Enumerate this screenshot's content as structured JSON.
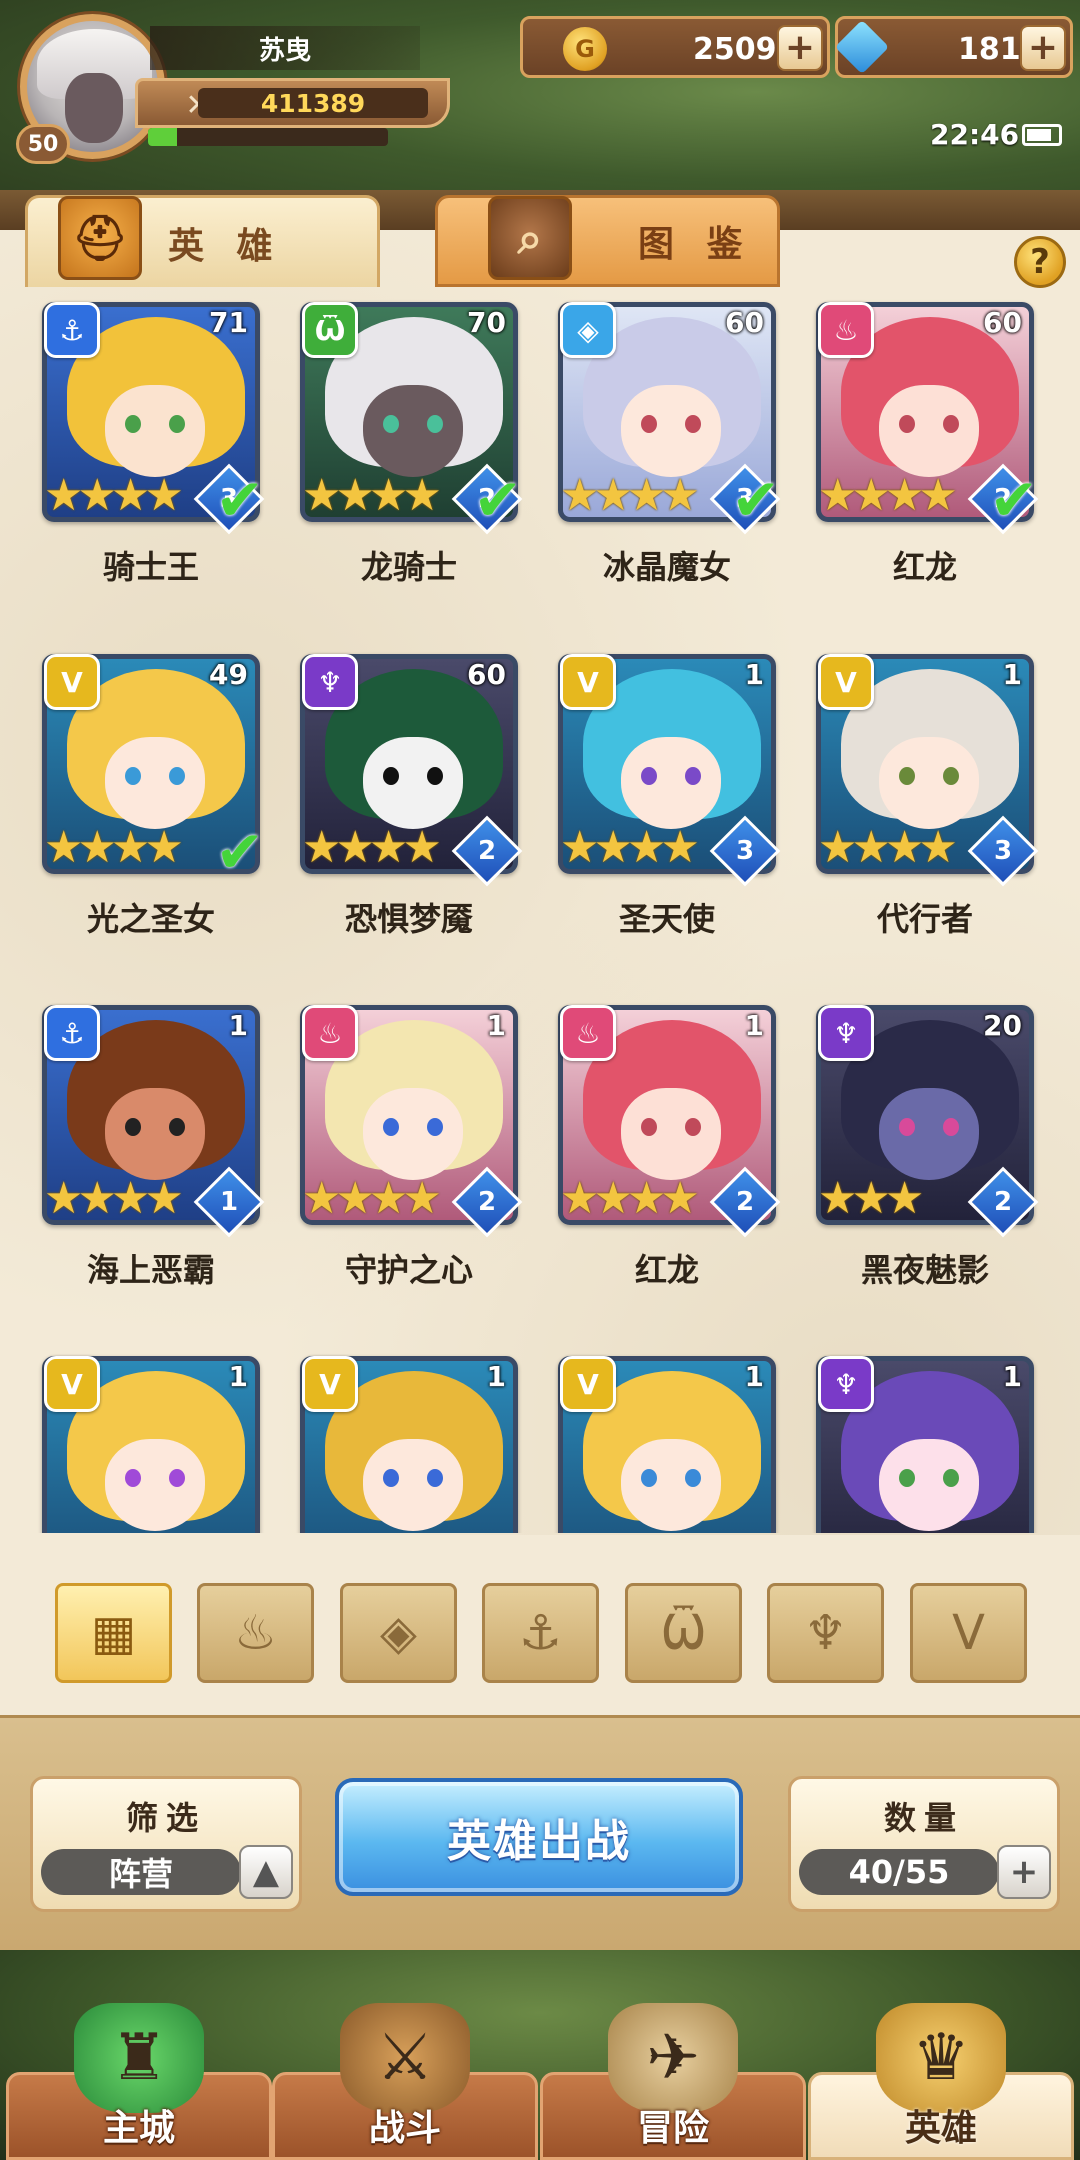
{
  "player": {
    "name": "苏曳",
    "level": "50",
    "power": "411389",
    "exp_fraction": 0.12
  },
  "currencies": {
    "gold": "2509",
    "gems": "181"
  },
  "status": {
    "time": "22:46"
  },
  "tabs": {
    "heroes": "英 雄",
    "codex": "图 鉴"
  },
  "heroes": [
    {
      "name": "骑士王",
      "level": "71",
      "rank": "3",
      "element": "anchor",
      "stars": 4,
      "checked": true
    },
    {
      "name": "龙骑士",
      "level": "70",
      "rank": "2",
      "element": "beast",
      "stars": 4,
      "checked": true
    },
    {
      "name": "冰晶魔女",
      "level": "60",
      "rank": "3",
      "element": "crystal",
      "stars": 4,
      "checked": true
    },
    {
      "name": "红龙",
      "level": "60",
      "rank": "2",
      "element": "flame",
      "stars": 4,
      "checked": true
    },
    {
      "name": "光之圣女",
      "level": "49",
      "rank": "",
      "element": "light",
      "stars": 4,
      "checked": true
    },
    {
      "name": "恐惧梦魇",
      "level": "60",
      "rank": "2",
      "element": "dark",
      "stars": 4,
      "checked": false
    },
    {
      "name": "圣天使",
      "level": "1",
      "rank": "3",
      "element": "light",
      "stars": 4,
      "checked": false
    },
    {
      "name": "代行者",
      "level": "1",
      "rank": "3",
      "element": "light",
      "stars": 4,
      "checked": false
    },
    {
      "name": "海上恶霸",
      "level": "1",
      "rank": "1",
      "element": "anchor",
      "stars": 4,
      "checked": false
    },
    {
      "name": "守护之心",
      "level": "1",
      "rank": "2",
      "element": "flame",
      "stars": 4,
      "checked": false
    },
    {
      "name": "红龙",
      "level": "1",
      "rank": "2",
      "element": "flame",
      "stars": 4,
      "checked": false
    },
    {
      "name": "黑夜魅影",
      "level": "20",
      "rank": "2",
      "element": "dark",
      "stars": 3,
      "checked": false
    },
    {
      "name": "",
      "level": "1",
      "rank": "",
      "element": "light",
      "stars": 0,
      "checked": false
    },
    {
      "name": "",
      "level": "1",
      "rank": "",
      "element": "light",
      "stars": 0,
      "checked": false
    },
    {
      "name": "",
      "level": "1",
      "rank": "",
      "element": "light",
      "stars": 0,
      "checked": false
    },
    {
      "name": "",
      "level": "1",
      "rank": "",
      "element": "dark",
      "stars": 0,
      "checked": false
    }
  ],
  "element_colors": {
    "anchor": "#2f6fe0",
    "beast": "#3fae3a",
    "crystal": "#3aa6e8",
    "flame": "#e04a78",
    "light": "#e6b81e",
    "dark": "#7a3ac8"
  },
  "element_icons": {
    "anchor": "⚓",
    "beast": "Ѿ",
    "crystal": "◈",
    "flame": "♨",
    "light": "V",
    "dark": "♆"
  },
  "filters": [
    {
      "name": "all",
      "icon": "▦",
      "active": true
    },
    {
      "name": "flame",
      "icon": "♨",
      "active": false
    },
    {
      "name": "crystal",
      "icon": "◈",
      "active": false
    },
    {
      "name": "anchor",
      "icon": "⚓",
      "active": false
    },
    {
      "name": "beast",
      "icon": "Ѿ",
      "active": false
    },
    {
      "name": "dark",
      "icon": "♆",
      "active": false
    },
    {
      "name": "light",
      "icon": "V",
      "active": false
    }
  ],
  "controls": {
    "filter_title": "筛选",
    "filter_value": "阵营",
    "deploy_label": "英雄出战",
    "count_title": "数量",
    "count_value": "40/55"
  },
  "nav": [
    {
      "label": "主城",
      "icon": "♜",
      "active": false
    },
    {
      "label": "战斗",
      "icon": "⚔",
      "active": false
    },
    {
      "label": "冒险",
      "icon": "✈",
      "active": false
    },
    {
      "label": "英雄",
      "icon": "♛",
      "active": true
    }
  ]
}
